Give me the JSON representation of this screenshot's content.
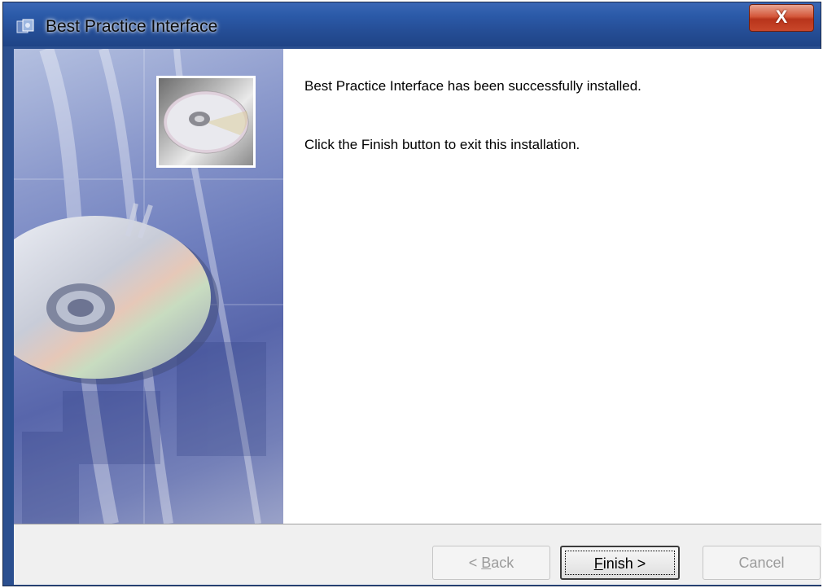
{
  "window": {
    "title": "Best Practice Interface",
    "close_glyph": "X"
  },
  "icons": {
    "app": "setup-cd-icon",
    "close": "close-icon",
    "banner": "cd-disc-banner",
    "thumbnail": "cd-disc-icon"
  },
  "main": {
    "message_line1": "Best Practice Interface has been successfully installed.",
    "message_line2": "Click the Finish button to exit this installation."
  },
  "buttons": {
    "back": {
      "prefix": "< ",
      "mnemonic": "B",
      "rest": "ack",
      "enabled": false
    },
    "finish": {
      "mnemonic": "F",
      "rest": "inish",
      "suffix": " >",
      "enabled": true,
      "focused": true
    },
    "cancel": {
      "label": "Cancel",
      "enabled": false
    }
  },
  "colors": {
    "title_bar": "#2b5aa8",
    "close_button": "#c9472a",
    "dialog_bg": "#ffffff",
    "button_bar": "#f0f0f0",
    "disabled_text": "#9b9b9b"
  }
}
